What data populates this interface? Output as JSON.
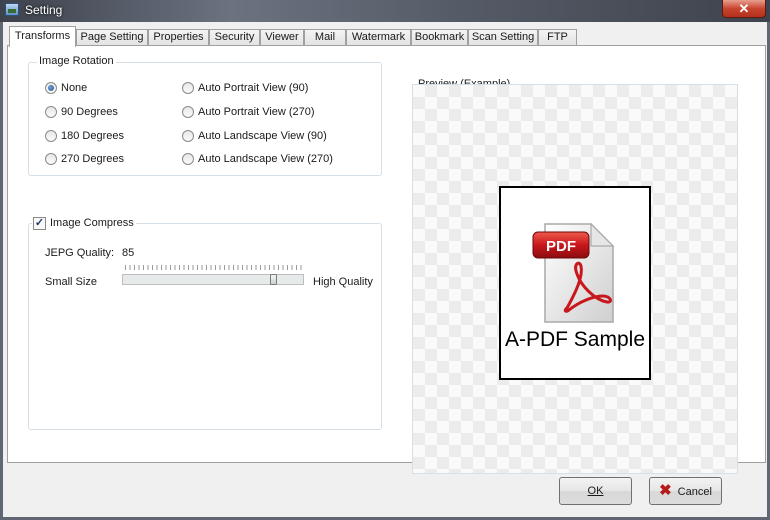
{
  "window": {
    "title": "Setting",
    "close_glyph": "✕"
  },
  "tabs": [
    {
      "label": "Transforms"
    },
    {
      "label": "Page Setting"
    },
    {
      "label": "Properties"
    },
    {
      "label": "Security"
    },
    {
      "label": "Viewer"
    },
    {
      "label": "Mail"
    },
    {
      "label": "Watermark"
    },
    {
      "label": "Bookmark"
    },
    {
      "label": "Scan Setting"
    },
    {
      "label": "FTP"
    }
  ],
  "rotation": {
    "legend": "Image Rotation",
    "selected": "None",
    "options": [
      {
        "label": "None",
        "checked": true
      },
      {
        "label": "90 Degrees",
        "checked": false
      },
      {
        "label": "180 Degrees",
        "checked": false
      },
      {
        "label": "270 Degrees",
        "checked": false
      },
      {
        "label": "Auto Portrait View (90)",
        "checked": false
      },
      {
        "label": "Auto Portrait View (270)",
        "checked": false
      },
      {
        "label": "Auto Landscape View (90)",
        "checked": false
      },
      {
        "label": "Auto Landscape View (270)",
        "checked": false
      }
    ]
  },
  "compress": {
    "label": "Image Compress",
    "checked": true,
    "quality_label": "JEPG Quality:",
    "quality_value": "85",
    "min_label": "Small Size",
    "max_label": "High Quality",
    "slider_fraction": 0.85
  },
  "preview": {
    "legend": "Preview (Example)",
    "badge_text": "PDF",
    "sample_text": "A-PDF Sample"
  },
  "buttons": {
    "ok_label": "OK",
    "cancel_label": "Cancel"
  },
  "colors": {
    "pdf_red": "#c8171d",
    "cancel_x": "#b51a1a"
  }
}
